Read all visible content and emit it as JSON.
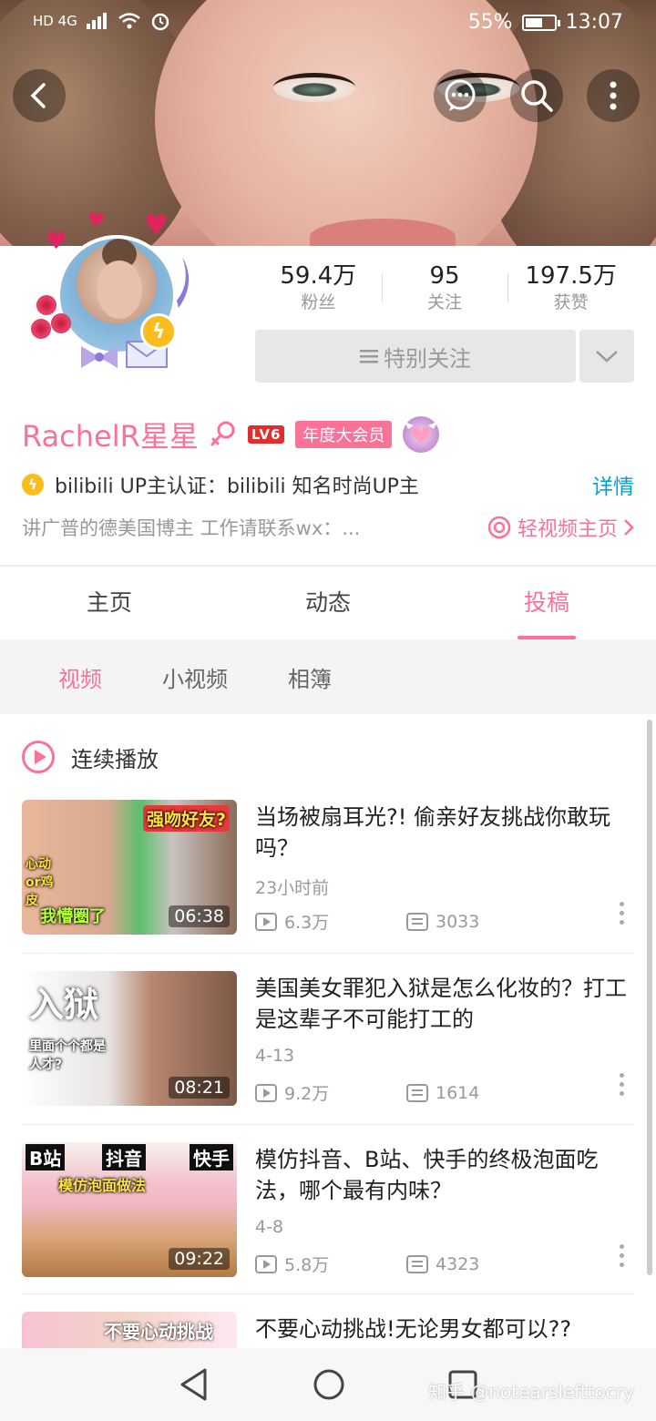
{
  "status": {
    "left": "HD 4G",
    "battery": "55%",
    "time": "13:07"
  },
  "profile": {
    "fans_count": "59.4万",
    "fans_label": "粉丝",
    "following_count": "95",
    "following_label": "关注",
    "likes_count": "197.5万",
    "likes_label": "获赞",
    "follow_button": "特别关注",
    "name": "RachelR星星",
    "level": "LV6",
    "vip_badge": "年度大会员",
    "cert_text": "bilibili UP主认证：bilibili 知名时尚UP主",
    "detail_link": "详情",
    "bio": "讲广普的德美国博主 工作请联系wx：...",
    "light_link": "轻视频主页"
  },
  "tabs": [
    "主页",
    "动态",
    "投稿"
  ],
  "subtabs": [
    "视频",
    "小视频",
    "相簿"
  ],
  "play_all": "连续播放",
  "videos": [
    {
      "title": "当场被扇耳光?! 偷亲好友挑战你敢玩吗？",
      "date": "23小时前",
      "views": "6.3万",
      "danmaku": "3033",
      "duration": "06:38",
      "caps": [
        "强吻好友?",
        "心动or鸡皮",
        "我懵圈了"
      ]
    },
    {
      "title": "美国美女罪犯入狱是怎么化妆的？打工是这辈子不可能打工的",
      "date": "4-13",
      "views": "9.2万",
      "danmaku": "1614",
      "duration": "08:21",
      "caps": [
        "入狱",
        "里面个个都是人才?"
      ]
    },
    {
      "title": "模仿抖音、B站、快手的终极泡面吃法，哪个最有内味？",
      "date": "4-8",
      "views": "5.8万",
      "danmaku": "4323",
      "duration": "09:22",
      "caps": [
        "B站",
        "抖音",
        "快手",
        "模仿泡面做法"
      ]
    },
    {
      "title": "不要心动挑战!无论男女都可以??",
      "caps": [
        "不要心动挑战"
      ]
    }
  ],
  "watermark": "知乎 @notearslefttocry",
  "colors": {
    "accent": "#fb7299",
    "link": "#00a1d6",
    "lv": "#e02d2d",
    "cert": "#fbbc1c"
  }
}
